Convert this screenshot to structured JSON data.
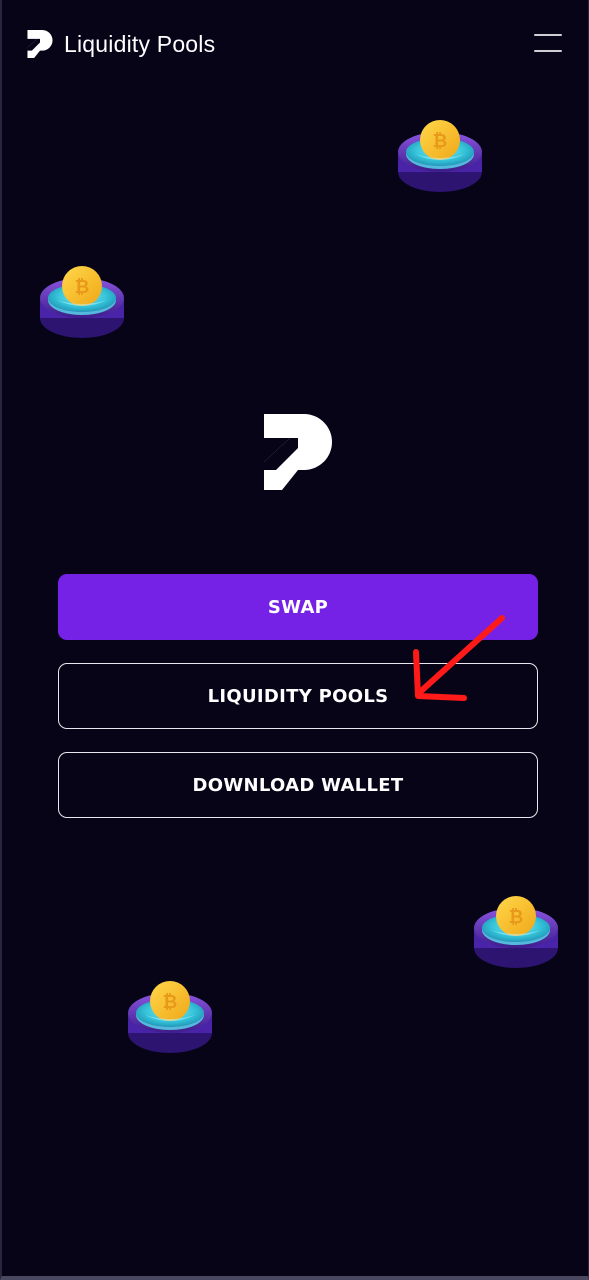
{
  "header": {
    "title": "Liquidity Pools",
    "logo_icon": "pancake-p-logo-icon",
    "menu_icon": "hamburger-menu-icon"
  },
  "main": {
    "logo_icon": "pancake-p-logo-icon",
    "buttons": {
      "swap": "SWAP",
      "liquidity_pools": "LIQUIDITY POOLS",
      "download_wallet": "DOWNLOAD WALLET"
    }
  },
  "decorations": {
    "pool_icon": "bitcoin-pool-icon",
    "annotation_icon": "red-arrow-icon"
  },
  "colors": {
    "background": "#070418",
    "accent": "#7522e6",
    "annotation": "#ff1a1a"
  }
}
